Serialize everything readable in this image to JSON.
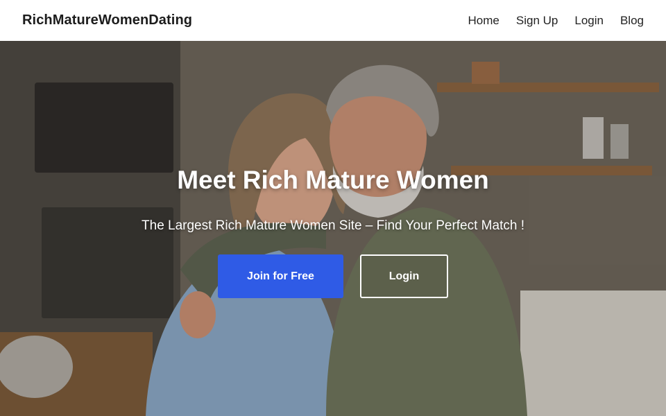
{
  "header": {
    "brand": "RichMatureWomenDating",
    "nav": [
      {
        "label": "Home"
      },
      {
        "label": "Sign Up"
      },
      {
        "label": "Login"
      },
      {
        "label": "Blog"
      }
    ]
  },
  "hero": {
    "title": "Meet Rich Mature Women",
    "subtitle": "The Largest Rich Mature Women Site – Find Your Perfect Match !",
    "primary_button": "Join for Free",
    "secondary_button": "Login",
    "image_description_icon": "couple-photo"
  },
  "colors": {
    "primary": "#2f5be6",
    "header_bg": "#ffffff",
    "text_dark": "#1c1c1c"
  }
}
